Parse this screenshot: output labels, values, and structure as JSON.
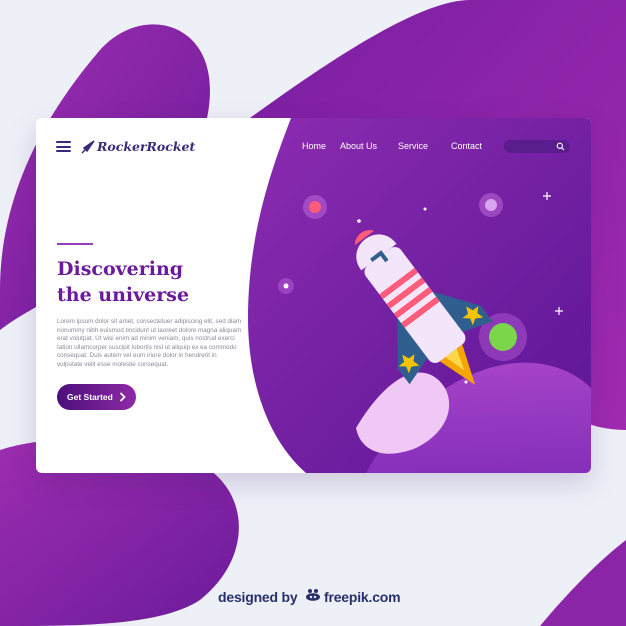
{
  "brand": {
    "name": "RockerRocket"
  },
  "nav": {
    "items": [
      "Home",
      "About Us",
      "Service",
      "Contact"
    ]
  },
  "search": {
    "placeholder": ""
  },
  "hero": {
    "title_line1": "Discovering",
    "title_line2": "the universe",
    "body": "Lorem ipsum dolor sit amet, consectetuer adipiscing elit, sed diam nonummy nibh euismod tincidunt ut laoreet dolore magna aliquam erat volutpat. Ut wisi enim ad minim veniam, quis nostrud exerci tation ullamcorper suscipit lobortis nisl ut aliquip ex ea commodo consequat. Duis autem vel eum iriure dolor in hendrerit in vulputate velit esse molestie consequat.",
    "cta_label": "Get Started"
  },
  "credit": {
    "prefix": "designed by",
    "brand": "freepik.com"
  },
  "colors": {
    "primary": "#6a1b9a",
    "accent": "#9b3fb8",
    "background": "#eef0f8",
    "planet_green": "#7bd64a",
    "rocket_blue": "#2f5f8f",
    "rocket_star": "#f5c400"
  },
  "icons": [
    "menu-icon",
    "rocket-logo-icon",
    "search-icon",
    "chevron-right-icon",
    "freepik-icon"
  ]
}
